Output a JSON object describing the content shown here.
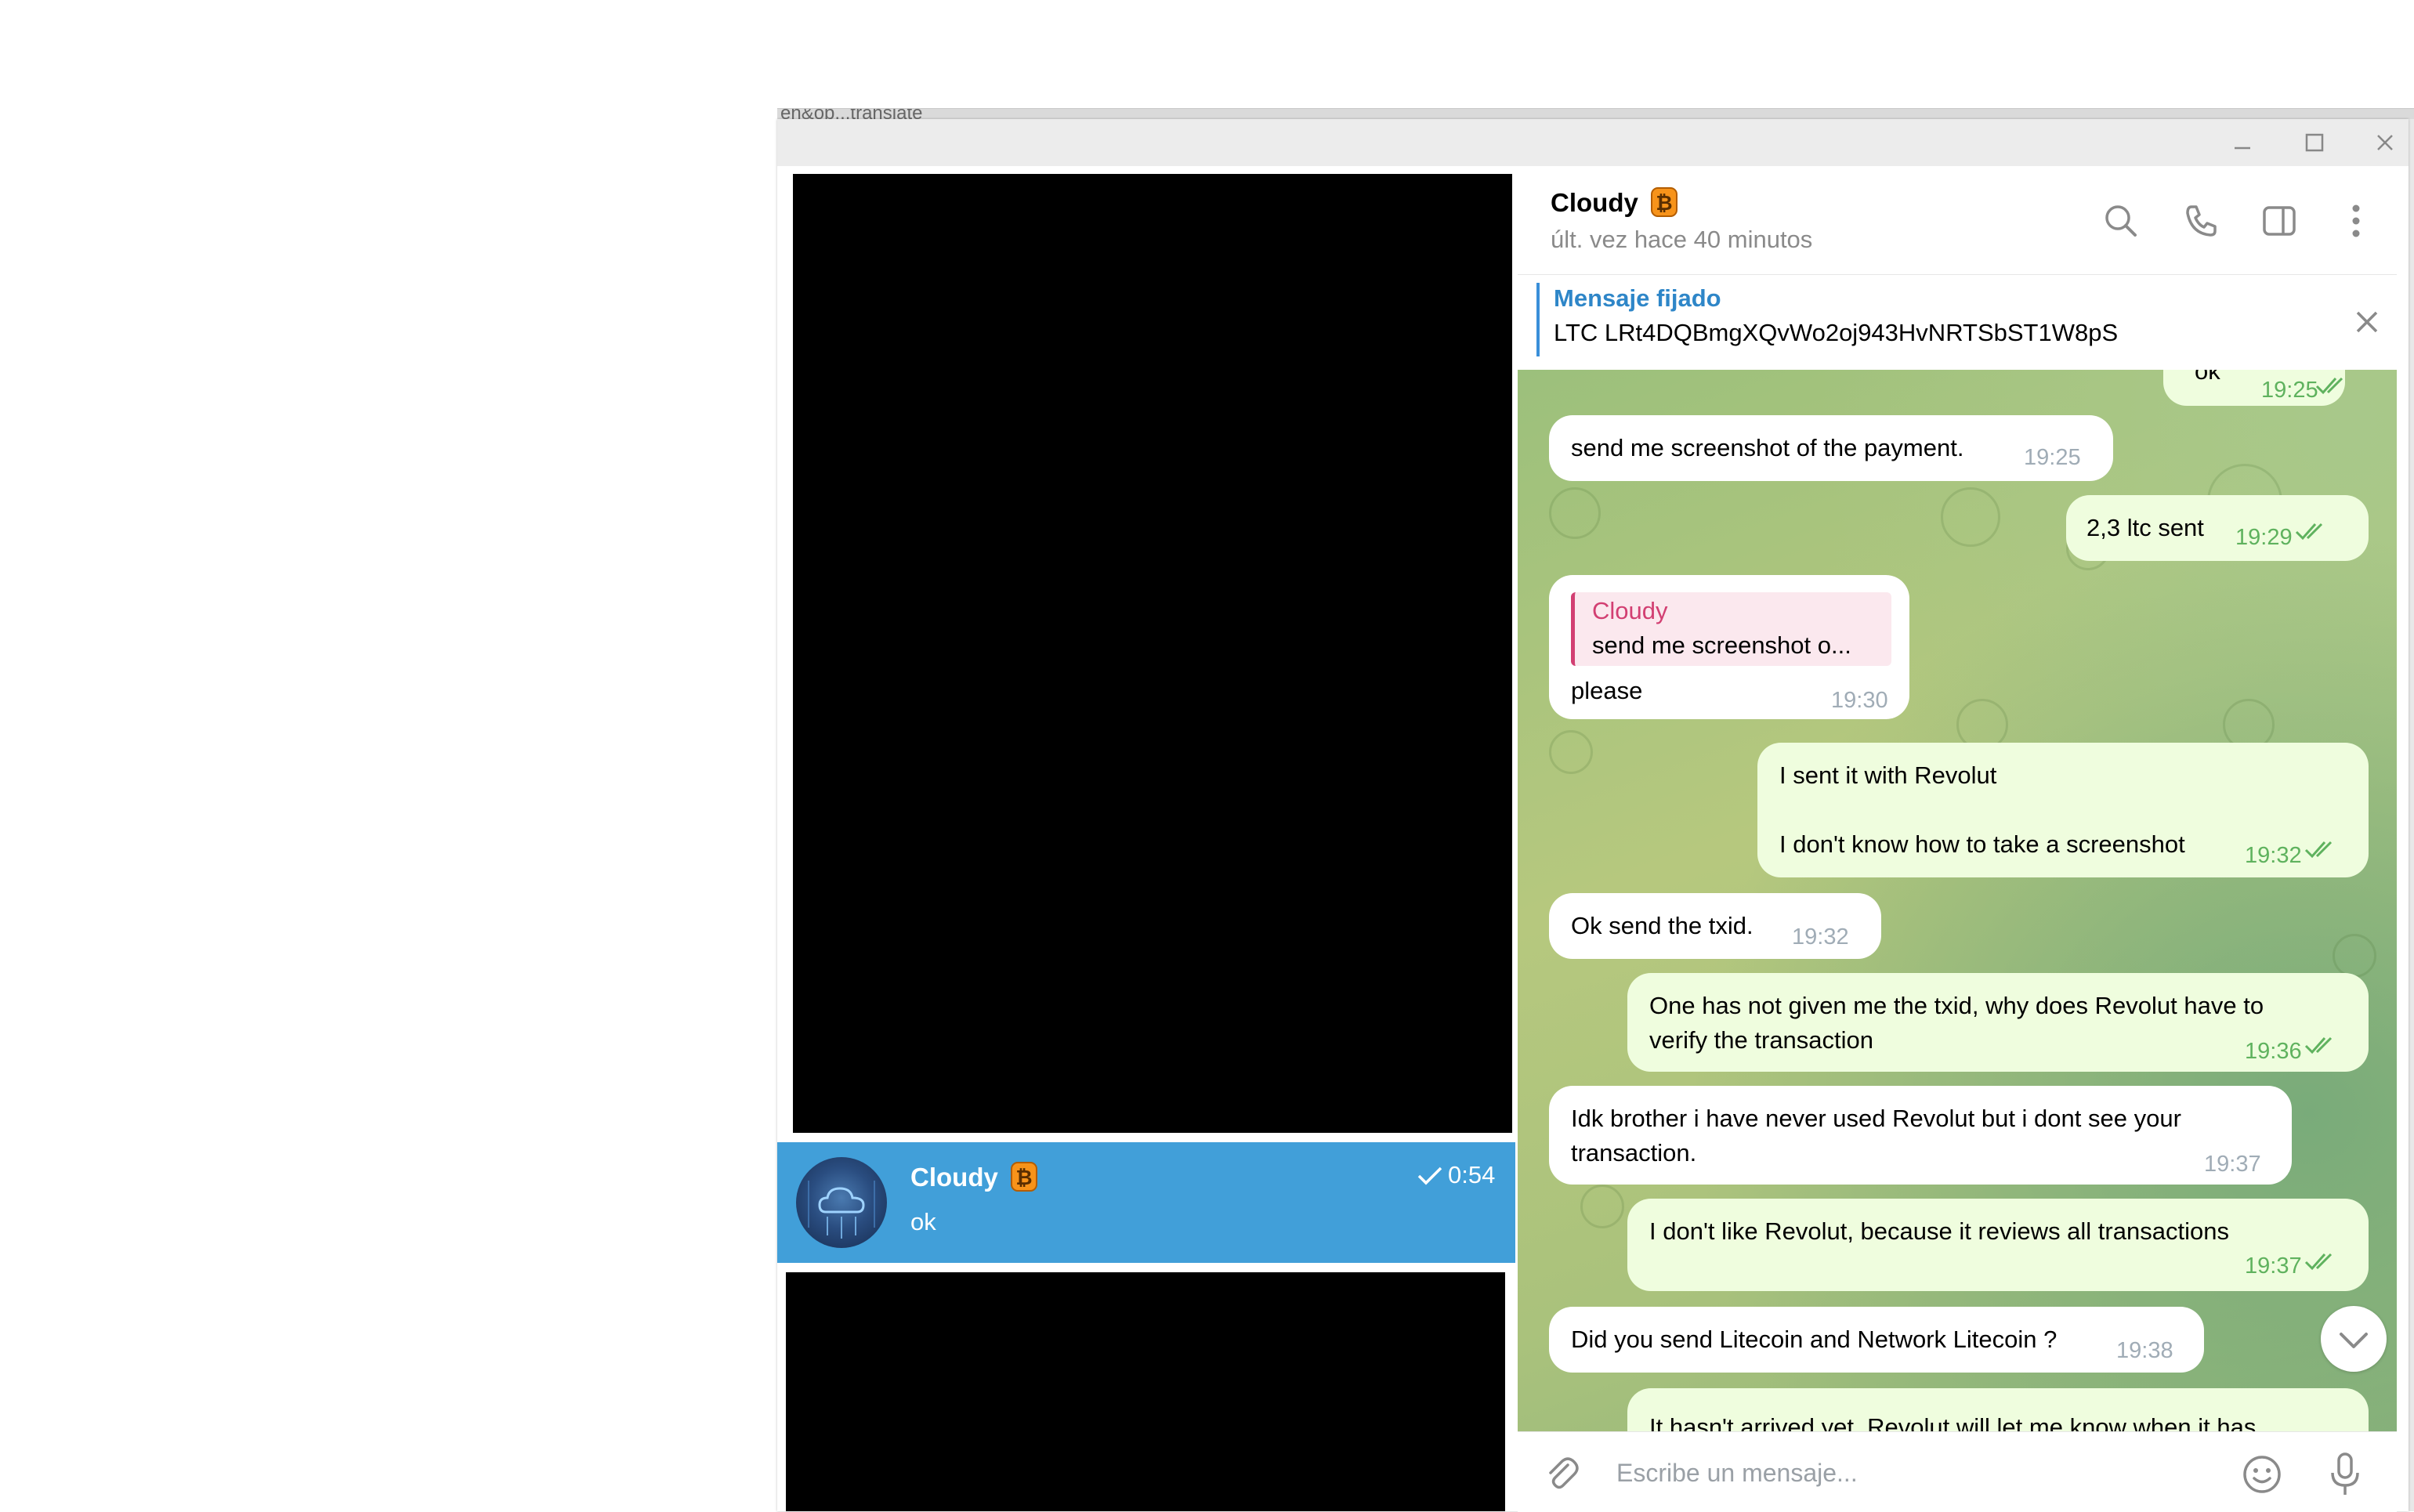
{
  "background": {
    "tab_text": "en&op...translate"
  },
  "window": {
    "controls": [
      "minimize",
      "maximize",
      "close"
    ]
  },
  "chat_list": {
    "selected_chat": {
      "name": "Cloudy",
      "emoji": "bitcoin-emoji",
      "time": "0:54",
      "last_message": "ok",
      "read": true
    }
  },
  "conversation": {
    "header": {
      "name": "Cloudy",
      "status": "últ. vez hace 40 minutos"
    },
    "header_icons": [
      "search-icon",
      "phone-icon",
      "sidebar-toggle-icon",
      "more-vertical-icon"
    ],
    "pinned": {
      "title": "Mensaje fijado",
      "text": "LTC LRt4DQBmgXQvWo2oj943HvNRTSbST1W8pS"
    },
    "messages": [
      {
        "dir": "out",
        "text": "ok",
        "time": "19:25"
      },
      {
        "dir": "in",
        "text": "send me screenshot of the payment.",
        "time": "19:25"
      },
      {
        "dir": "out",
        "text": "2,3 ltc sent",
        "time": "19:29"
      },
      {
        "dir": "in",
        "reply_name": "Cloudy",
        "reply_text": "send me screenshot o...",
        "text": "please",
        "time": "19:30"
      },
      {
        "dir": "out",
        "line1": "I sent it with Revolut",
        "line2": "I don't know how to take a screenshot",
        "time": "19:32"
      },
      {
        "dir": "in",
        "text": "Ok send the txid.",
        "time": "19:32"
      },
      {
        "dir": "out",
        "line1": "One has not given me the txid, why does Revolut have to",
        "line2": "verify the transaction",
        "time": "19:36"
      },
      {
        "dir": "in",
        "line1": "Idk brother i have never used Revolut but i dont see your",
        "line2": "transaction.",
        "time": "19:37"
      },
      {
        "dir": "out",
        "text": "I don't like Revolut, because it reviews all transactions",
        "time": "19:37"
      },
      {
        "dir": "in",
        "text": "Did you send Litecoin and Network Litecoin ?",
        "time": "19:38"
      },
      {
        "dir": "out",
        "text": "It hasn't arrived yet. Revolut will let me know when it has",
        "time": ""
      }
    ],
    "composer": {
      "placeholder": "Escribe un mensaje..."
    }
  },
  "colors": {
    "accent": "#419fd9",
    "pinned_title": "#2e86c8",
    "reply_name": "#d23f72",
    "out_bubble": "#effdde",
    "read_ticks": "#5fb25e"
  }
}
